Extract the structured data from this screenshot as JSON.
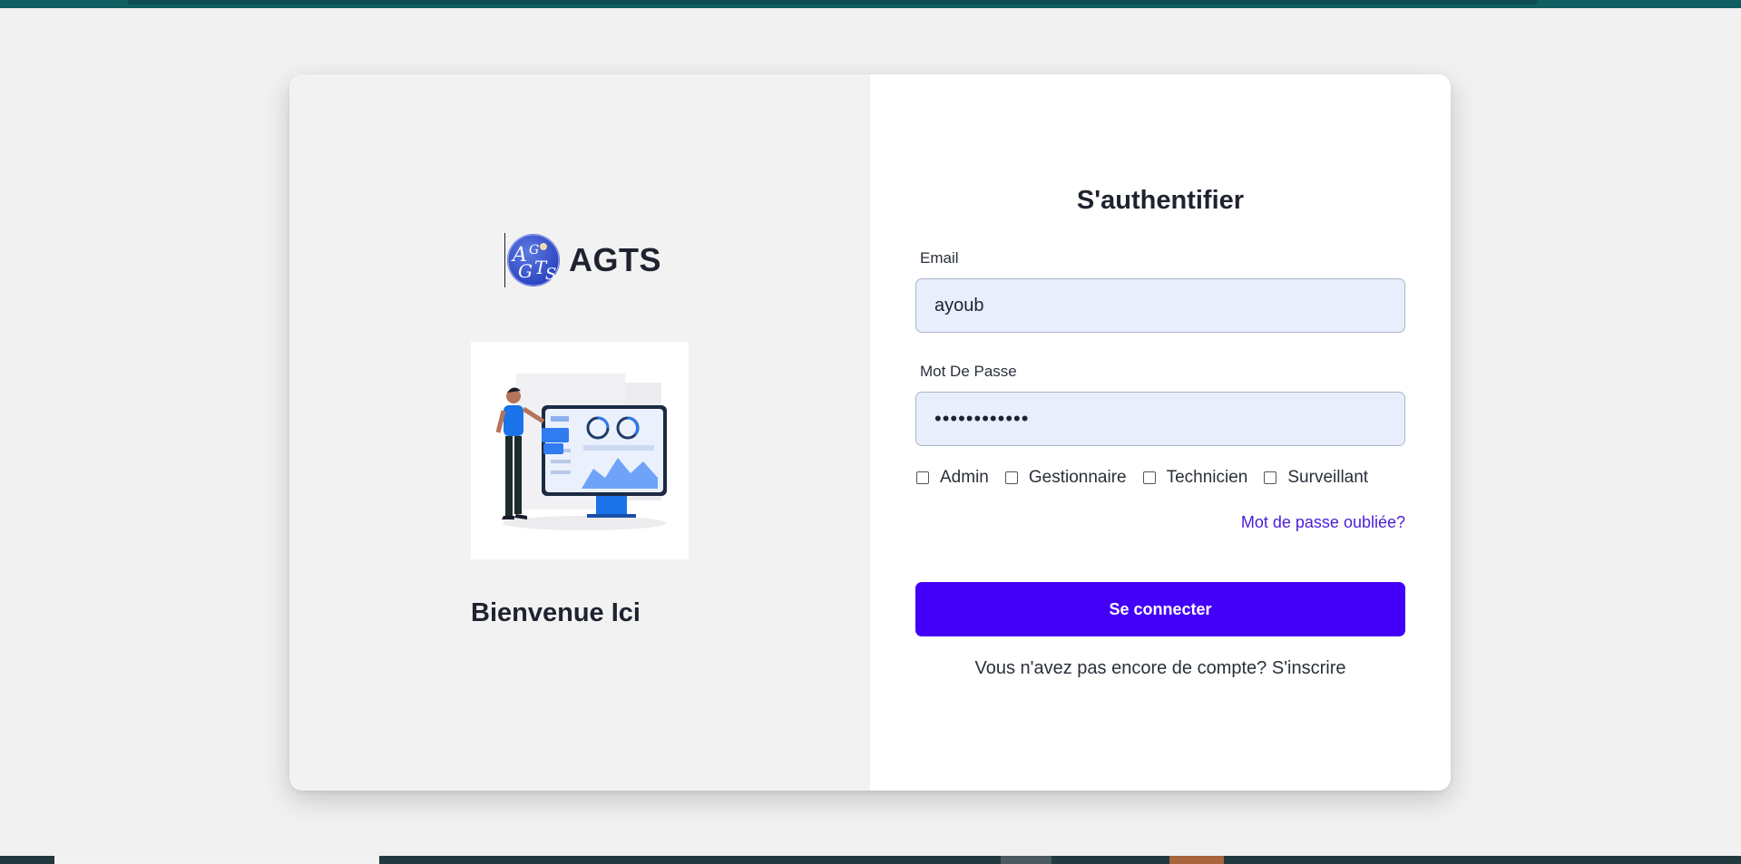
{
  "brand": {
    "name": "AGTS",
    "logo_text": "AGTS",
    "logo_icon": "agts-globe-logo"
  },
  "left": {
    "welcome": "Bienvenue Ici",
    "illustration_icon": "dashboard-presenter-illustration"
  },
  "auth": {
    "title": "S'authentifier",
    "email_label": "Email",
    "email_value": "ayoub",
    "password_label": "Mot De Passe",
    "password_value": "••••••••••••",
    "roles": [
      {
        "label": "Admin",
        "checked": false
      },
      {
        "label": "Gestionnaire",
        "checked": false
      },
      {
        "label": "Technicien",
        "checked": false
      },
      {
        "label": "Surveillant",
        "checked": false
      }
    ],
    "forgot_link": "Mot de passe oubliée?",
    "submit_label": "Se connecter",
    "signup_text": "Vous n'avez pas encore de compte? S'inscrire"
  },
  "colors": {
    "primary": "#4300f9",
    "link": "#4a1dd6",
    "input_bg": "#e8eefb",
    "topbar": "#0f5e61",
    "page_bg": "#f1f1f1"
  }
}
